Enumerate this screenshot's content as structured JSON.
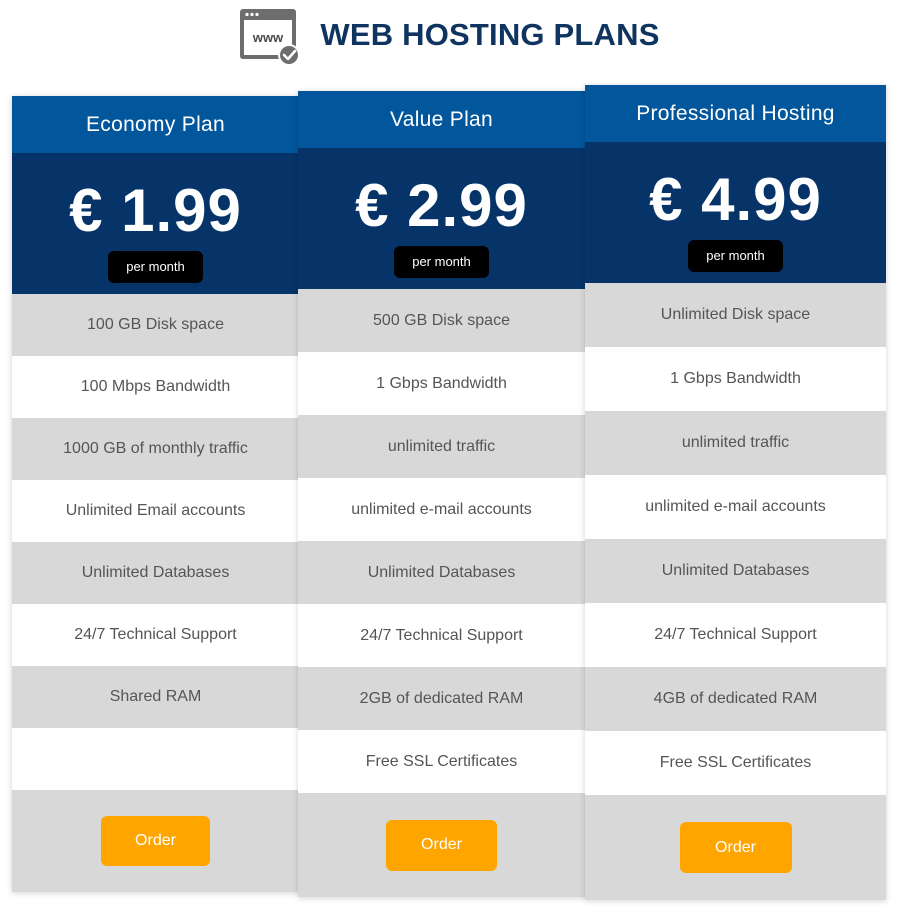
{
  "header": {
    "title": "WEB HOSTING PLANS",
    "icon": "www-browser-check-icon",
    "icon_text": "www"
  },
  "colors": {
    "title": "#0f3460",
    "plan_name_bg": "#02569c",
    "price_bg": "#063468",
    "row_gray": "#d8d8d8",
    "order_button": "#ffa500"
  },
  "plans": [
    {
      "name": "Economy Plan",
      "price": "€ 1.99",
      "period": "per month",
      "features": [
        "100 GB Disk space",
        "100 Mbps Bandwidth",
        "1000 GB of monthly traffic",
        "Unlimited Email accounts",
        "Unlimited Databases",
        "24/7 Technical Support",
        "Shared RAM",
        ""
      ],
      "order_label": "Order"
    },
    {
      "name": "Value Plan",
      "price": "€ 2.99",
      "period": "per month",
      "features": [
        "500 GB Disk space",
        "1 Gbps Bandwidth",
        "unlimited traffic",
        "unlimited e-mail accounts",
        "Unlimited Databases",
        "24/7 Technical Support",
        "2GB of dedicated RAM",
        "Free SSL Certificates"
      ],
      "order_label": "Order"
    },
    {
      "name": "Professional Hosting",
      "price": "€ 4.99",
      "period": "per month",
      "features": [
        "Unlimited Disk space",
        "1 Gbps Bandwidth",
        "unlimited traffic",
        "unlimited e-mail accounts",
        "Unlimited Databases",
        "24/7 Technical Support",
        "4GB of dedicated RAM",
        "Free SSL Certificates"
      ],
      "order_label": "Order"
    }
  ]
}
